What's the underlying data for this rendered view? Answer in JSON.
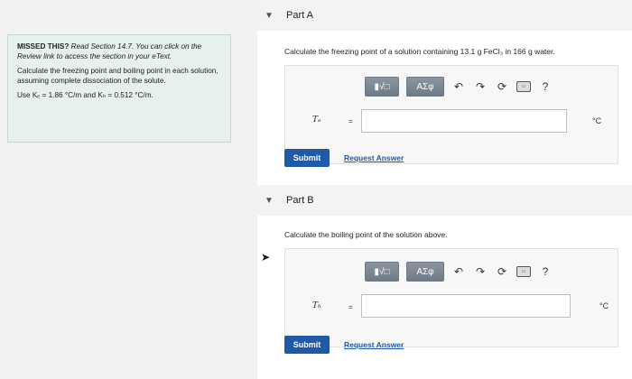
{
  "left_panel": {
    "missed_title": "MISSED THIS?",
    "missed_text": "Read Section 14.7. You can click on the Review link to access the section in your eText.",
    "calc_text": "Calculate the freezing point and boiling point in each solution, assuming complete dissociation of the solute.",
    "constants_text": "Use Kₑ = 1.86 °C/m and Kₕ = 0.512 °C/m."
  },
  "part_a": {
    "label": "Part A",
    "question": "Calculate the freezing point of a solution containing 13.1 g FeCl₃ in 166 g water.",
    "variable": "Tₑ",
    "equals": "=",
    "unit": "°C",
    "submit_label": "Submit",
    "request_label": "Request Answer"
  },
  "part_b": {
    "label": "Part B",
    "question": "Calculate the boiling point of the solution above.",
    "variable": "Tₕ",
    "equals": "=",
    "unit": "°C",
    "submit_label": "Submit",
    "request_label": "Request Answer"
  },
  "toolbar": {
    "template_label": "▮√□",
    "greek_label": "AΣφ",
    "help_label": "?"
  }
}
